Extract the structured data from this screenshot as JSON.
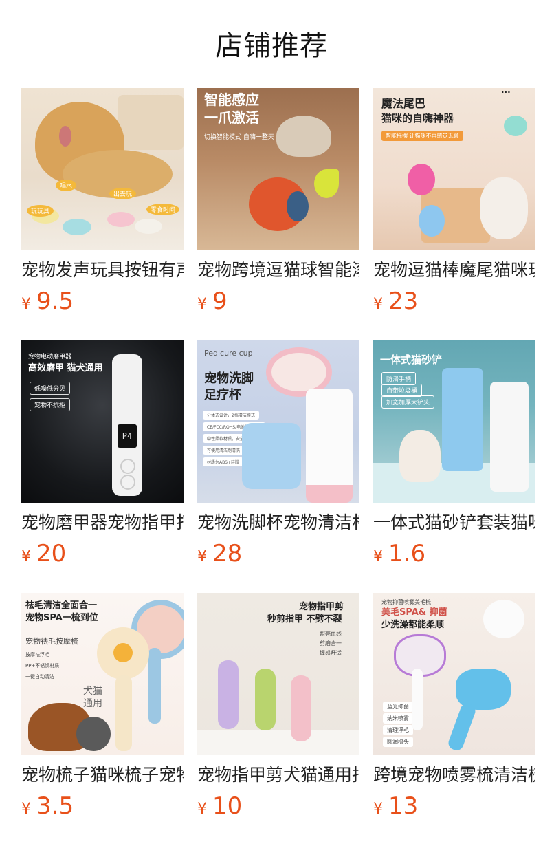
{
  "header": {
    "title": "店铺推荐"
  },
  "currency_symbol": "¥",
  "accent": "#e8501a",
  "products": [
    {
      "name": "宠物发声玩具按钮有声",
      "price": "9.5",
      "image": {
        "icon": "dog-with-buttons-image",
        "tags": [
          "喝水",
          "出去玩",
          "玩玩具",
          "零食时间"
        ]
      }
    },
    {
      "name": "宠物跨境逗猫球智能滚动",
      "price": "9",
      "image": {
        "icon": "cat-toy-ball-image",
        "heading1": "智能感应",
        "heading2": "一爪激活",
        "sub": "切换智能模式 自嗨一整天"
      }
    },
    {
      "name": "宠物逗猫棒魔尾猫咪玩具",
      "price": "23",
      "image": {
        "icon": "cat-tail-wand-image",
        "heading1": "魔法尾巴",
        "heading2": "猫咪的自嗨神器",
        "sub": "智能摇摆 让猫咪不再感觉无聊"
      }
    },
    {
      "name": "宠物磨甲器宠物指甲打磨器",
      "price": "20",
      "image": {
        "icon": "nail-grinder-image",
        "heading0": "宠物电动磨甲器",
        "heading1": "高效磨甲 猫犬通用",
        "tags": [
          "低噪低分贝",
          "宠物不抗拒"
        ],
        "display": "P4"
      }
    },
    {
      "name": "宠物洗脚杯宠物清洁杯",
      "price": "28",
      "image": {
        "icon": "paw-cup-image",
        "heading0": "Pedicure cup",
        "heading1": "宠物洗脚",
        "heading2": "足疗杯",
        "tags": [
          "分体式设计，2挡清洁模式",
          "CE/FCC/ROHS/电池报告齐全",
          "中性柔软材质，安全放心",
          "可使用清洁剂清洗",
          "材质为ABS+硅胶"
        ]
      }
    },
    {
      "name": "一体式猫砂铲套装猫咪用品",
      "price": "1.6",
      "image": {
        "icon": "litter-scoop-image",
        "heading1": "一体式猫砂铲",
        "tags": [
          "防滑手柄",
          "自带垃圾桶",
          "加宽加厚大铲头"
        ]
      }
    },
    {
      "name": "宠物梳子猫咪梳子宠物用品",
      "price": "3.5",
      "image": {
        "icon": "pet-comb-image",
        "heading1": "祛毛清洁全面合一",
        "heading2": "宠物SPA一梳到位",
        "sub": "宠物祛毛按摩梳",
        "tags": [
          "按摩祛浮毛",
          "PP+不锈钢材质",
          "一键自动清洁"
        ],
        "badge1": "犬猫",
        "badge2": "通用"
      }
    },
    {
      "name": "宠物指甲剪犬猫通用指甲剪",
      "price": "10",
      "image": {
        "icon": "nail-clipper-image",
        "heading1": "宠物指甲剪",
        "heading2": "秒剪指甲 不劈不裂",
        "tags": [
          "照亮血线",
          "剪磨合一",
          "握感舒适"
        ]
      }
    },
    {
      "name": "跨境宠物喷雾梳清洁梳子",
      "price": "13",
      "image": {
        "icon": "spray-comb-image",
        "heading0": "宠物抑菌喷雾美毛梳",
        "heading1": "美毛SPA& 抑菌",
        "heading2": "少洗澡都能柔顺",
        "tags": [
          "蓝光抑菌",
          "纳米喷雾",
          "清理浮毛",
          "圆润梳头"
        ]
      }
    }
  ]
}
